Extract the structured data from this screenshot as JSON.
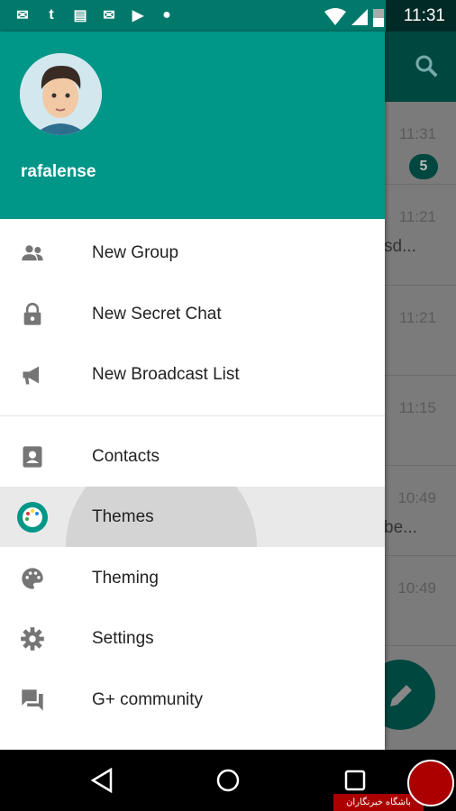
{
  "status_bar": {
    "time": "11:31",
    "notification_icons": [
      "gmail-icon",
      "tumblr-icon",
      "news-icon",
      "gmail-icon",
      "play-store-icon",
      "android-icon"
    ],
    "system_icons": [
      "wifi-icon",
      "signal-icon",
      "battery-charging-icon"
    ]
  },
  "background_list": {
    "rows": [
      {
        "time": "11:31",
        "badge": "5",
        "preview": ""
      },
      {
        "time": "11:21",
        "preview": "sd..."
      },
      {
        "time": "11:21",
        "preview": ""
      },
      {
        "time": "11:15",
        "preview": ""
      },
      {
        "time": "10:49",
        "preview": "be..."
      },
      {
        "time": "10:49",
        "preview": ""
      }
    ]
  },
  "drawer": {
    "username": "rafalense",
    "items": [
      {
        "label": "New Group",
        "icon": "group-icon"
      },
      {
        "label": "New Secret Chat",
        "icon": "lock-icon"
      },
      {
        "label": "New Broadcast List",
        "icon": "megaphone-icon"
      },
      {
        "label": "Contacts",
        "icon": "contact-icon"
      },
      {
        "label": "Themes",
        "icon": "palette-colored-icon"
      },
      {
        "label": "Theming",
        "icon": "palette-icon"
      },
      {
        "label": "Settings",
        "icon": "gear-icon"
      },
      {
        "label": "G+ community",
        "icon": "forum-icon"
      }
    ]
  },
  "watermark": {
    "text": "باشگاه خبرنگاران"
  },
  "colors": {
    "primary": "#009688",
    "status": "#00796b",
    "selected": "#e9e9e9"
  }
}
